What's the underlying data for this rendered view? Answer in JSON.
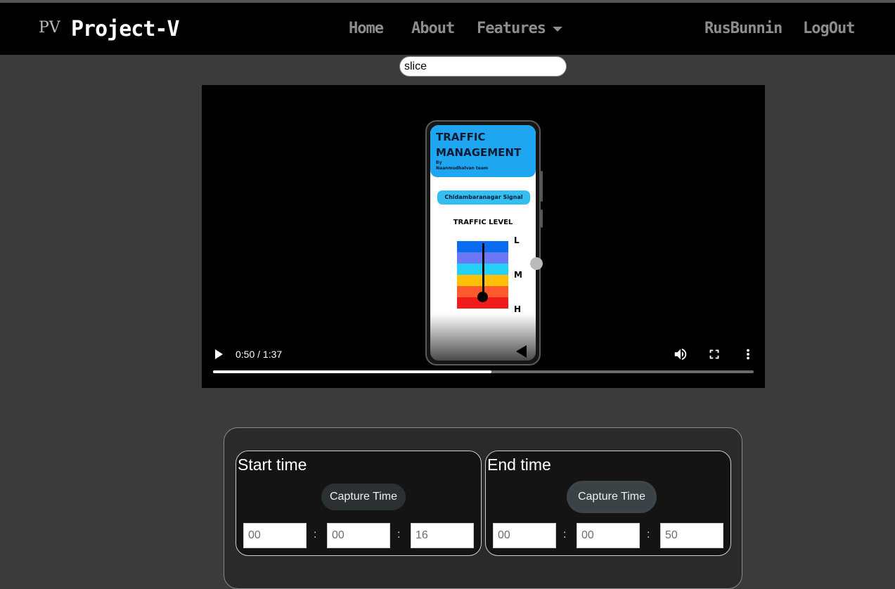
{
  "navbar": {
    "logo_text": "PV",
    "brand": "Project-V",
    "links": [
      "Home",
      "About"
    ],
    "features_label": "Features",
    "user": "RusBunnin",
    "logout": "LogOut"
  },
  "search": {
    "value": "slice"
  },
  "video": {
    "current_time": "0:50",
    "duration": "1:37",
    "time_display": "0:50 / 1:37",
    "progress_fraction": 0.515,
    "frame": {
      "app_title": "TRAFFIC MANAGEMENT",
      "app_by": "By",
      "app_team": "Naanmudhalvan team",
      "signal_name": "Chidambaranagar Signal",
      "level_title": "TRAFFIC LEVEL",
      "level_low": "L",
      "level_mid": "M",
      "level_high": "H",
      "meter_colors": [
        "#0b6cf0",
        "#6b78f5",
        "#24d0f5",
        "#ffc107",
        "#ff5a2b",
        "#f21b1b"
      ]
    },
    "icons": [
      "play-icon",
      "volume-icon",
      "fullscreen-icon",
      "more-options-icon"
    ]
  },
  "capture": {
    "start": {
      "title": "Start time",
      "button": "Capture Time",
      "hours": "00",
      "minutes": "00",
      "seconds": "16"
    },
    "end": {
      "title": "End time",
      "button": "Capture Time",
      "hours": "00",
      "minutes": "00",
      "seconds": "50"
    },
    "separator": ":"
  }
}
